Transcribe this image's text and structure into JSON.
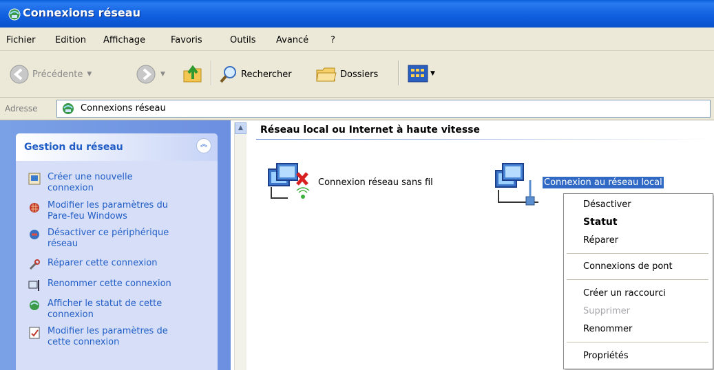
{
  "window": {
    "title": "Connexions réseau"
  },
  "menubar": [
    "Fichier",
    "Edition",
    "Affichage",
    "Favoris",
    "Outils",
    "Avancé",
    "?"
  ],
  "toolbar": {
    "back_label": "Précédente",
    "search_label": "Rechercher",
    "folders_label": "Dossiers"
  },
  "address": {
    "label": "Adresse",
    "value": "Connexions réseau"
  },
  "task_pane": {
    "title": "Gestion du réseau",
    "tasks": [
      {
        "label_line1": "Créer une nouvelle",
        "label_line2": "connexion",
        "icon": "new-connection-icon"
      },
      {
        "label_line1": "Modifier les paramètres du",
        "label_line2": "Pare-feu Windows",
        "icon": "firewall-icon"
      },
      {
        "label_line1": "Désactiver ce périphérique",
        "label_line2": "réseau",
        "icon": "disable-device-icon"
      },
      {
        "label_line1": "Réparer cette connexion",
        "label_line2": "",
        "icon": "repair-icon"
      },
      {
        "label_line1": "Renommer cette connexion",
        "label_line2": "",
        "icon": "rename-icon"
      },
      {
        "label_line1": "Afficher le statut de cette",
        "label_line2": "connexion",
        "icon": "status-icon"
      },
      {
        "label_line1": "Modifier les paramètres de",
        "label_line2": "cette connexion",
        "icon": "properties-icon"
      }
    ]
  },
  "content": {
    "section_title": "Réseau local ou Internet à haute vitesse",
    "items": [
      {
        "label": "Connexion réseau sans fil",
        "icon": "wireless-network-disabled-icon"
      },
      {
        "label": "Connexion au réseau local",
        "icon": "lan-connection-icon",
        "selected": true
      }
    ]
  },
  "context_menu": {
    "items": {
      "disable": "Désactiver",
      "status": "Statut",
      "repair": "Réparer",
      "bridge": "Connexions de pont",
      "shortcut": "Créer un raccourci",
      "delete": "Supprimer",
      "rename": "Renommer",
      "properties": "Propriétés"
    }
  },
  "colors": {
    "titlebar": "#0a52cc",
    "task_link": "#215dc6",
    "selection": "#316ac5"
  }
}
